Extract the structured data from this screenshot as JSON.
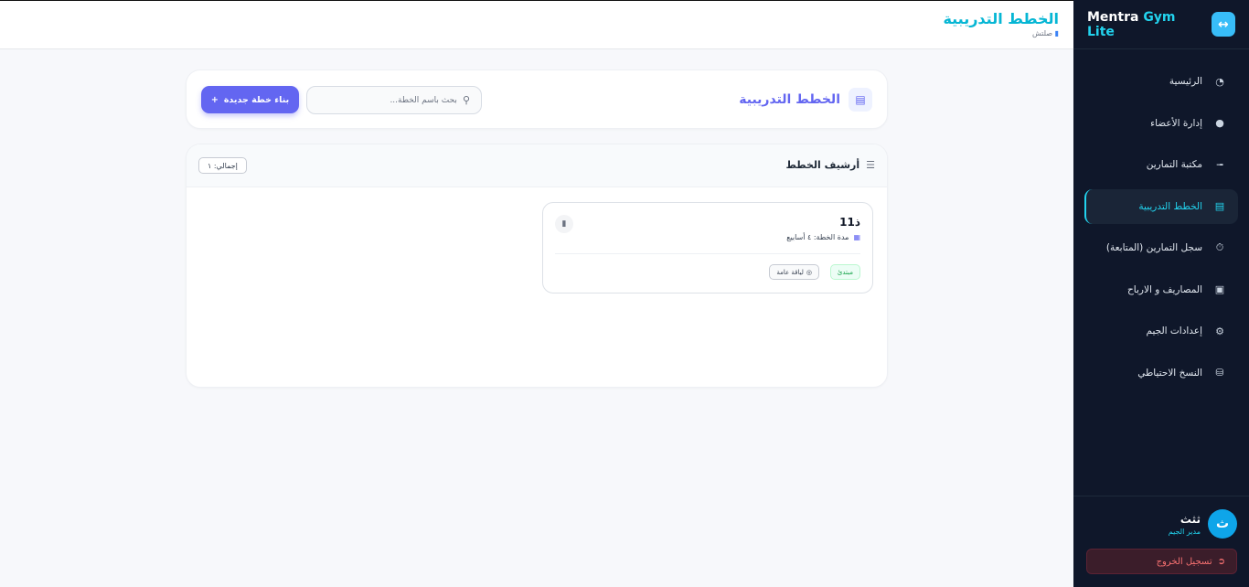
{
  "app": {
    "brand_main": "Mentra",
    "brand_accent": "Gym Lite",
    "accent_color": "#22d3ee",
    "primary_color": "#6366f1"
  },
  "topbar": {
    "title": "الخطط التدريبية",
    "subtitle": "صلتش"
  },
  "sidebar": {
    "items": [
      {
        "label": "الرئيسية",
        "icon": "pie-chart-icon"
      },
      {
        "label": "إدارة الأعضاء",
        "icon": "users-icon"
      },
      {
        "label": "مكتبة التمارين",
        "icon": "dumbbell-icon"
      },
      {
        "label": "الخطط التدريبية",
        "icon": "clipboard-icon"
      },
      {
        "label": "سجل التمارين (المتابعة)",
        "icon": "stopwatch-icon"
      },
      {
        "label": "المصاريف و الارباح",
        "icon": "wallet-icon"
      },
      {
        "label": "إعدادات الجيم",
        "icon": "gear-icon"
      },
      {
        "label": "النسخ الاحتياطي",
        "icon": "database-icon"
      }
    ],
    "active_index": 3
  },
  "user": {
    "initial": "ث",
    "name": "ثثث",
    "role": "مدير الجيم",
    "logout_label": "تسجيل الخروج"
  },
  "header": {
    "title": "الخطط التدريبية",
    "search_placeholder": "بحث باسم الخطة...",
    "new_button_label": "بناء خطة جديدة"
  },
  "archive": {
    "title": "أرشيف الخطط",
    "total_label": "إجمالي: ١"
  },
  "plans": [
    {
      "name": "ذ11",
      "duration": "مدة الخطة: ٤ أسابيع",
      "level": "مبتدئ",
      "goal": "لياقة عامة"
    }
  ]
}
